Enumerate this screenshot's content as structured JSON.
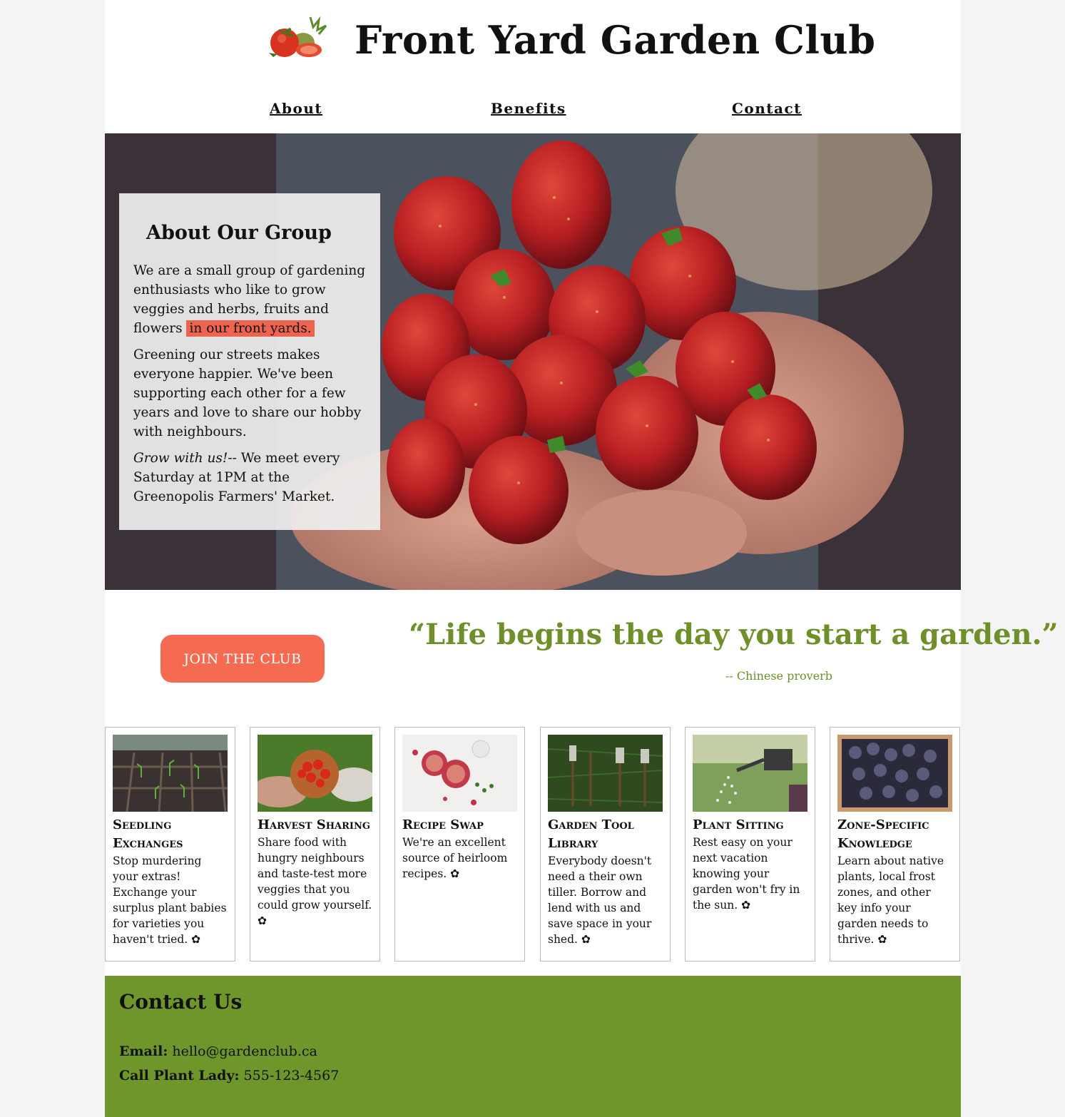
{
  "header": {
    "title": "Front Yard Garden Club",
    "logo_icon": "tomato-logo-icon"
  },
  "nav": {
    "items": [
      "About",
      "Benefits",
      "Contact"
    ]
  },
  "about": {
    "title": "About Our Group",
    "p1_start": "We are a small group of gardening enthusiasts who like to grow veggies and herbs, fruits and flowers ",
    "p1_highlight": "in our front yards.",
    "p2": "Greening our streets makes everyone happier. We've been supporting each other for a few years and love to share our hobby with neighbours.",
    "p3_em": "Grow with us!",
    "p3_rest": "-- We meet every Saturday at 1PM at the Greenopolis Farmers' Market."
  },
  "cta": {
    "join_label": "JOIN THE CLUB"
  },
  "quote": {
    "text": "“Life begins the day you start a garden.”",
    "attribution": "-- Chinese proverb"
  },
  "cards": [
    {
      "title": "Seedling Exchanges",
      "text": "Stop murdering your extras! Exchange your surplus plant babies for varieties you haven't tried.  ✿",
      "icon": "seedlings-image"
    },
    {
      "title": "Harvest Sharing",
      "text": "Share food with hungry neighbours and taste-test more veggies that you could grow yourself. ✿",
      "icon": "tomatoes-bowl-image"
    },
    {
      "title": "Recipe Swap",
      "text": "We're an excellent source of heirloom recipes. ✿",
      "icon": "pies-image"
    },
    {
      "title": "Garden Tool Library",
      "text": "Everybody doesn't need a their own tiller. Borrow and lend with us and save space in your shed. ✿",
      "icon": "garden-tools-image"
    },
    {
      "title": "Plant Sitting",
      "text": "Rest easy on your next vacation knowing your garden won't fry in the sun. ✿",
      "icon": "watering-can-image"
    },
    {
      "title": "Zone-Specific Knowledge",
      "text": "Learn about native plants, local frost zones, and other key info your garden needs to thrive. ✿",
      "icon": "blackberries-image"
    }
  ],
  "contact": {
    "title": "Contact Us",
    "email_label": "Email:",
    "email_value": "hello@gardenclub.ca",
    "phone_label": "Call Plant Lady:",
    "phone_value": "555-123-4567"
  },
  "colors": {
    "accent": "#f56b52",
    "highlight": "#ef6450",
    "green": "#6e962a",
    "quote_green": "#6e8f2a"
  }
}
